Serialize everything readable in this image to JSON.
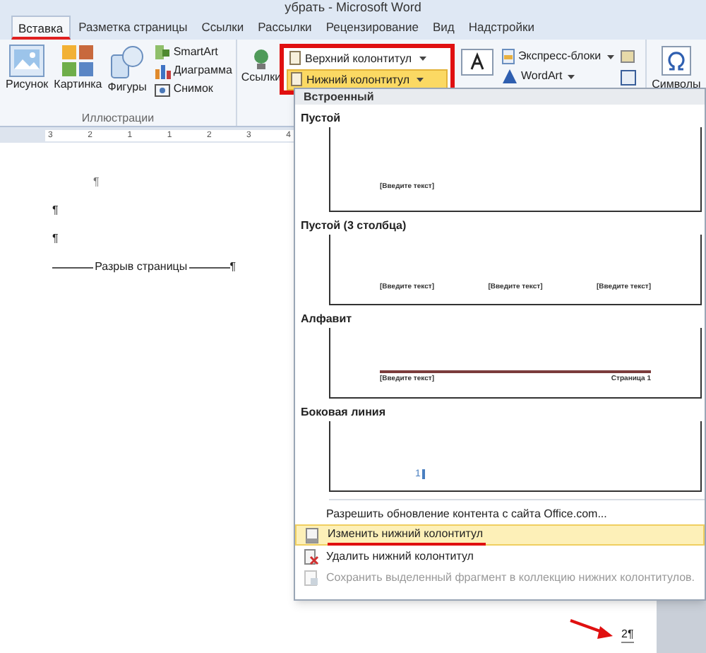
{
  "window": {
    "title": "убрать - Microsoft Word"
  },
  "tabs": [
    {
      "label": "Вставка",
      "selected": true
    },
    {
      "label": "Разметка страницы",
      "selected": false
    },
    {
      "label": "Ссылки",
      "selected": false
    },
    {
      "label": "Рассылки",
      "selected": false
    },
    {
      "label": "Рецензирование",
      "selected": false
    },
    {
      "label": "Вид",
      "selected": false
    },
    {
      "label": "Надстройки",
      "selected": false
    }
  ],
  "ribbon": {
    "large_buttons": [
      {
        "label": "Рисунок",
        "kind": "picture"
      },
      {
        "label": "Картинка",
        "kind": "clipart"
      },
      {
        "label": "Фигуры",
        "kind": "shapes"
      }
    ],
    "small_buttons": [
      {
        "label": "SmartArt",
        "kind": "smartart"
      },
      {
        "label": "Диаграмма",
        "kind": "chart"
      },
      {
        "label": "Снимок",
        "kind": "screenshot"
      }
    ],
    "group_label": "Иллюстрации",
    "links_button": "Ссылки",
    "header_buttons": [
      {
        "label": "Верхний колонтитул",
        "selected": false
      },
      {
        "label": "Нижний колонтитул",
        "selected": true
      }
    ],
    "text_items": [
      {
        "label": "Экспресс-блоки",
        "kind": "quickparts"
      },
      {
        "label": "WordArt",
        "kind": "wordart"
      }
    ],
    "symbols": "Символы"
  },
  "ruler": [
    "3",
    "2",
    "1",
    "1",
    "2",
    "3",
    "4"
  ],
  "document": {
    "marks": [
      "¶",
      "¶",
      "¶"
    ],
    "page_break": "Разрыв страницы",
    "page_break_mark": "¶",
    "page_number": "2¶"
  },
  "dropdown": {
    "header": "Встроенный",
    "gallery": [
      {
        "title": "Пустой",
        "kind": "blank",
        "fields": [
          "[Введите текст]"
        ]
      },
      {
        "title": "Пустой (3 столбца)",
        "kind": "three_columns",
        "fields": [
          "[Введите текст]",
          "[Введите текст]",
          "[Введите текст]"
        ]
      },
      {
        "title": "Алфавит",
        "kind": "alphabet",
        "fields": [
          "[Введите текст]",
          "Страница 1"
        ]
      },
      {
        "title": "Боковая линия",
        "kind": "sideline",
        "fields": [
          "1"
        ]
      }
    ],
    "menu": [
      {
        "label": "Разрешить обновление контента с сайта Office.com...",
        "kind": "none",
        "selected": false,
        "disabled": false
      },
      {
        "label": "Изменить нижний колонтитул",
        "kind": "edit",
        "selected": true,
        "disabled": false
      },
      {
        "label": "Удалить нижний колонтитул",
        "kind": "delete",
        "selected": false,
        "disabled": false
      },
      {
        "label": "Сохранить выделенный фрагмент в коллекцию нижних колонтитулов.",
        "kind": "save",
        "selected": false,
        "disabled": true
      }
    ]
  }
}
